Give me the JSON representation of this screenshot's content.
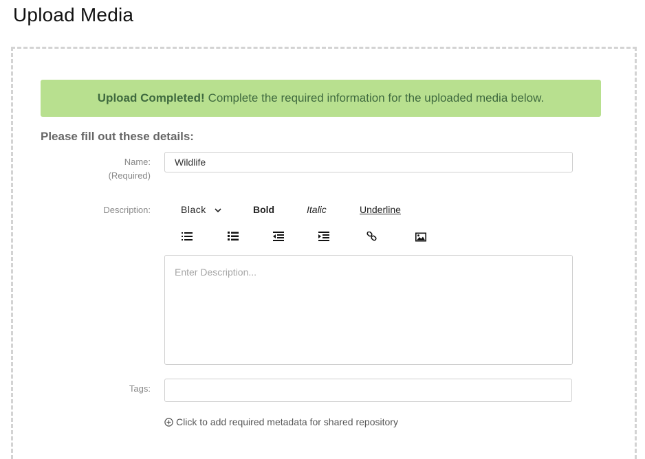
{
  "page": {
    "title": "Upload Media"
  },
  "alert": {
    "strong": "Upload Completed!",
    "message": "Complete the required information for the uploaded media below."
  },
  "form": {
    "heading": "Please fill out these details:",
    "name": {
      "label": "Name:",
      "sublabel": "(Required)",
      "value": "Wildlife"
    },
    "description": {
      "label": "Description:",
      "placeholder": "Enter Description...",
      "toolbar": {
        "color": "Black",
        "bold": "Bold",
        "italic": "Italic",
        "underline": "Underline",
        "icons": [
          "ordered-list-icon",
          "bullet-list-icon",
          "outdent-icon",
          "indent-icon",
          "link-icon",
          "image-icon"
        ]
      }
    },
    "tags": {
      "label": "Tags:",
      "value": ""
    },
    "metadata_link": "Click to add required metadata for shared repository"
  }
}
